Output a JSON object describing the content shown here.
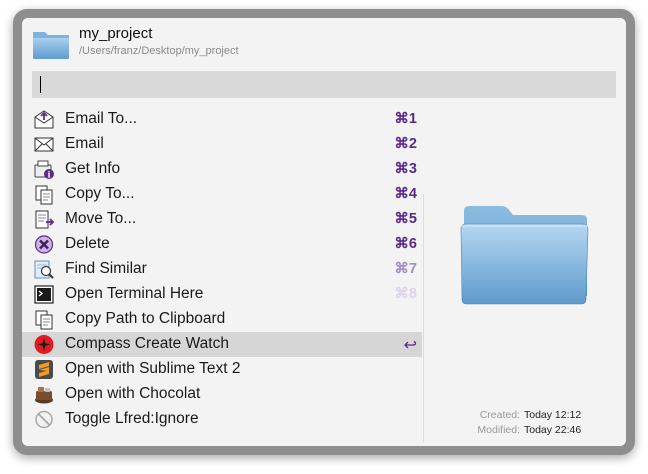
{
  "header": {
    "title": "my_project",
    "path": "/Users/franz/Desktop/my_project"
  },
  "search": {
    "value": ""
  },
  "actions": [
    {
      "label": "Email To...",
      "shortcut": "⌘1",
      "icon": "email-to-icon",
      "sc_color": "#5b2a8a"
    },
    {
      "label": "Email",
      "shortcut": "⌘2",
      "icon": "envelope-icon",
      "sc_color": "#5b2a8a"
    },
    {
      "label": "Get Info",
      "shortcut": "⌘3",
      "icon": "get-info-icon",
      "sc_color": "#5b2a8a"
    },
    {
      "label": "Copy To...",
      "shortcut": "⌘4",
      "icon": "copy-to-icon",
      "sc_color": "#5b2a8a"
    },
    {
      "label": "Move To...",
      "shortcut": "⌘5",
      "icon": "move-to-icon",
      "sc_color": "#5b2a8a"
    },
    {
      "label": "Delete",
      "shortcut": "⌘6",
      "icon": "delete-icon",
      "sc_color": "#5b2a8a"
    },
    {
      "label": "Find Similar",
      "shortcut": "⌘7",
      "icon": "find-similar-icon",
      "sc_color": "#a58dc4"
    },
    {
      "label": "Open Terminal Here",
      "shortcut": "⌘8",
      "icon": "terminal-icon",
      "sc_color": "#ddd3ea"
    },
    {
      "label": "Copy Path to Clipboard",
      "shortcut": "",
      "icon": "clipboard-icon",
      "sc_color": "#5b2a8a"
    },
    {
      "label": "Compass Create Watch",
      "shortcut": "↩",
      "icon": "compass-icon",
      "sc_color": "#5b2a8a",
      "selected": true
    },
    {
      "label": "Open with Sublime Text 2",
      "shortcut": "",
      "icon": "sublime-text-icon",
      "sc_color": "#5b2a8a"
    },
    {
      "label": "Open with Chocolat",
      "shortcut": "",
      "icon": "chocolat-icon",
      "sc_color": "#5b2a8a"
    },
    {
      "label": "Toggle Lfred:Ignore",
      "shortcut": "",
      "icon": "ignore-icon",
      "sc_color": "#5b2a8a"
    }
  ],
  "preview": {
    "created_label": "Created:",
    "created_value": "Today 12:12",
    "modified_label": "Modified:",
    "modified_value": "Today 22:46"
  },
  "colors": {
    "accent": "#5b2a8a",
    "selected_row": "#d6d6d6",
    "search_bg": "#d9d9d9"
  }
}
